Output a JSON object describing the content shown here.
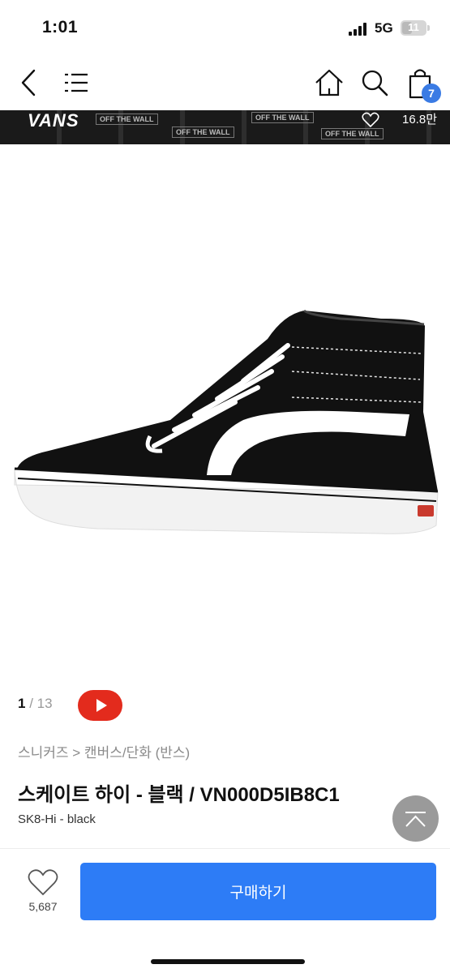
{
  "status_bar": {
    "time": "1:01",
    "network": "5G",
    "battery": "11"
  },
  "header": {
    "cart_count": "7"
  },
  "banner": {
    "logo": "VANS",
    "likes": "16.8만",
    "tile_text": "OFF THE WALL"
  },
  "gallery": {
    "current": "1",
    "separator": " / ",
    "total": "13"
  },
  "product": {
    "breadcrumb": "스니커즈 > 캔버스/단화 (반스)",
    "title": "스케이트 하이 - 블랙 / VN000D5IB8C1",
    "subtitle": "SK8-Hi - black"
  },
  "footer": {
    "like_count": "5,687",
    "buy_label": "구매하기"
  },
  "colors": {
    "accent": "#2d7cf6",
    "badge": "#3a7be4",
    "youtube": "#e32b1d"
  }
}
